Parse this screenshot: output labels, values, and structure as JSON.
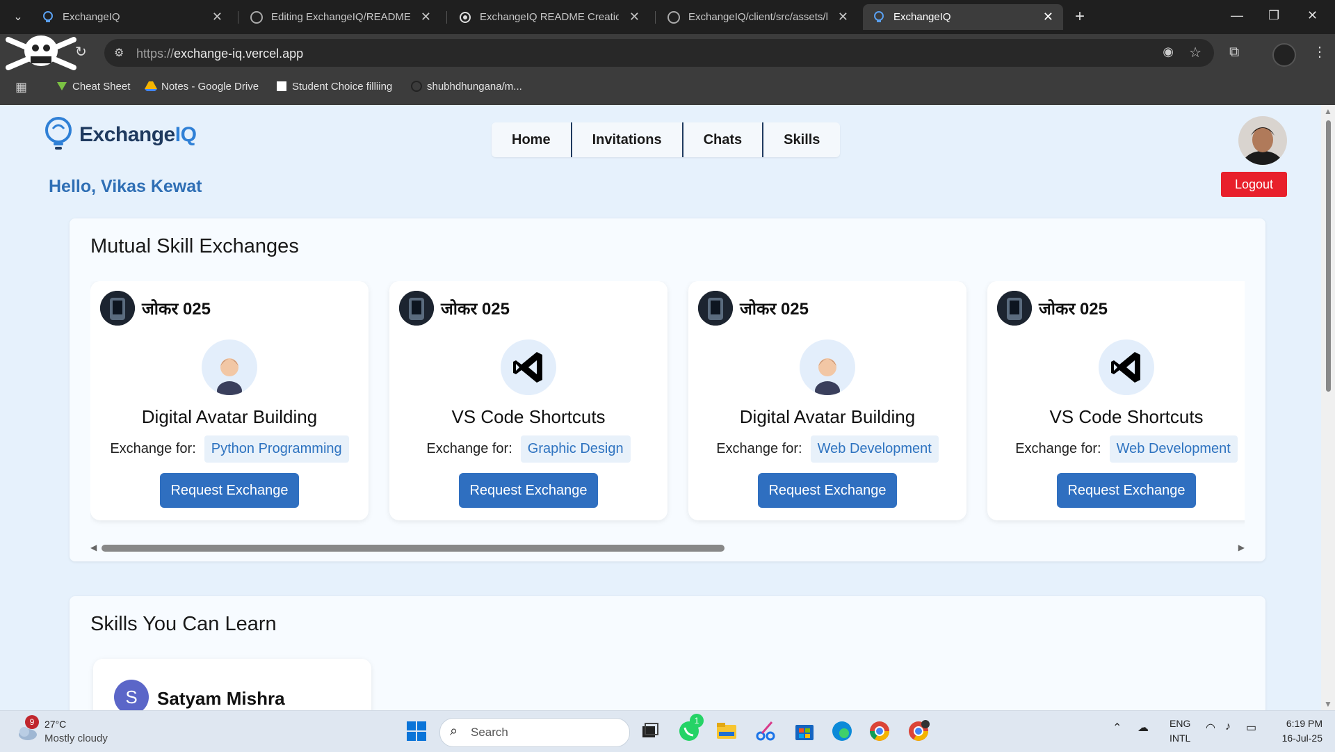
{
  "browser": {
    "tabs": [
      {
        "title": "ExchangeIQ",
        "active": false
      },
      {
        "title": "Editing ExchangeIQ/README.md",
        "active": false
      },
      {
        "title": "ExchangeIQ README Creation",
        "active": false
      },
      {
        "title": "ExchangeIQ/client/src/assets/lo",
        "active": false
      },
      {
        "title": "ExchangeIQ",
        "active": true
      }
    ],
    "url_scheme": "https://",
    "url_host": "exchange-iq.vercel.app",
    "bookmarks": [
      "Cheat Sheet",
      "Notes - Google Drive",
      "Student Choice filliing",
      "shubhdhungana/m..."
    ]
  },
  "app": {
    "logo_main": "Exchange",
    "logo_accent": "IQ",
    "nav": [
      "Home",
      "Invitations",
      "Chats",
      "Skills"
    ],
    "greeting": "Hello, Vikas Kewat",
    "logout_label": "Logout",
    "accent_color": "#2f6fc0",
    "logout_color": "#e8202b"
  },
  "mutual": {
    "title": "Mutual Skill Exchanges",
    "exchange_label": "Exchange for:",
    "button_label": "Request Exchange",
    "cards": [
      {
        "user": "जोकर 025",
        "skill": "Digital Avatar Building",
        "icon": "person-avatar-icon",
        "exchange_for": "Python Programming"
      },
      {
        "user": "जोकर 025",
        "skill": "VS Code Shortcuts",
        "icon": "vscode-icon",
        "exchange_for": "Graphic Design"
      },
      {
        "user": "जोकर 025",
        "skill": "Digital Avatar Building",
        "icon": "person-avatar-icon",
        "exchange_for": "Web Development"
      },
      {
        "user": "जोकर 025",
        "skill": "VS Code Shortcuts",
        "icon": "vscode-icon",
        "exchange_for": "Web Development"
      }
    ]
  },
  "learn": {
    "title": "Skills You Can Learn",
    "cards": [
      {
        "initial": "S",
        "user": "Satyam Mishra"
      }
    ]
  },
  "taskbar": {
    "weather_badge": "9",
    "weather_temp": "27°C",
    "weather_desc": "Mostly cloudy",
    "search_label": "Search",
    "whatsapp_badge": "1",
    "lang_top": "ENG",
    "lang_bottom": "INTL",
    "time": "6:19 PM",
    "date": "16-Jul-25"
  }
}
